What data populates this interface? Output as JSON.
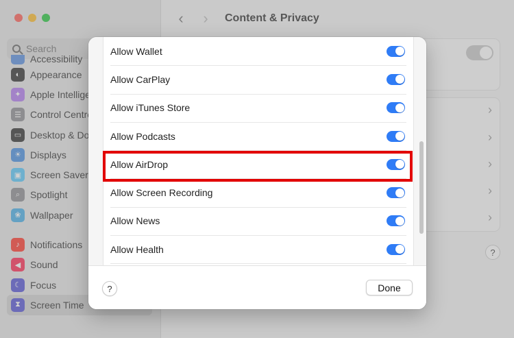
{
  "window": {
    "title": "Content & Privacy",
    "back_icon": "‹",
    "forward_icon": "›"
  },
  "sidebar": {
    "search_placeholder": "Search",
    "items": [
      {
        "label": "Accessibility",
        "icon": "accessibility-icon",
        "color": "#5a8fe0"
      },
      {
        "label": "Appearance",
        "icon": "appearance-icon",
        "color": "#333333"
      },
      {
        "label": "Apple Intelligence & Siri",
        "icon": "apple-intelligence-icon",
        "color": "#b27cf0"
      },
      {
        "label": "Control Centre",
        "icon": "control-centre-icon",
        "color": "#8e8e93"
      },
      {
        "label": "Desktop & Dock",
        "icon": "desktop-dock-icon",
        "color": "#333333"
      },
      {
        "label": "Displays",
        "icon": "displays-icon",
        "color": "#4a90e2"
      },
      {
        "label": "Screen Saver",
        "icon": "screen-saver-icon",
        "color": "#5ac8fa"
      },
      {
        "label": "Spotlight",
        "icon": "spotlight-icon",
        "color": "#8e8e93"
      },
      {
        "label": "Wallpaper",
        "icon": "wallpaper-icon",
        "color": "#4ab0e8"
      },
      {
        "label": "Notifications",
        "icon": "notifications-icon",
        "color": "#ff3b30"
      },
      {
        "label": "Sound",
        "icon": "sound-icon",
        "color": "#ff2d55"
      },
      {
        "label": "Focus",
        "icon": "focus-icon",
        "color": "#5856d6"
      },
      {
        "label": "Screen Time",
        "icon": "screen-time-icon",
        "color": "#5856d6"
      }
    ]
  },
  "sheet": {
    "rows": [
      {
        "label": "Allow Wallet",
        "on": true
      },
      {
        "label": "Allow CarPlay",
        "on": true
      },
      {
        "label": "Allow iTunes Store",
        "on": true
      },
      {
        "label": "Allow Podcasts",
        "on": true
      },
      {
        "label": "Allow AirDrop",
        "on": true
      },
      {
        "label": "Allow Screen Recording",
        "on": true
      },
      {
        "label": "Allow News",
        "on": true
      },
      {
        "label": "Allow Health",
        "on": true
      }
    ],
    "help_label": "?",
    "done_label": "Done"
  },
  "colors": {
    "toggle_on": "#2f7cf6",
    "highlight": "#e20000"
  }
}
